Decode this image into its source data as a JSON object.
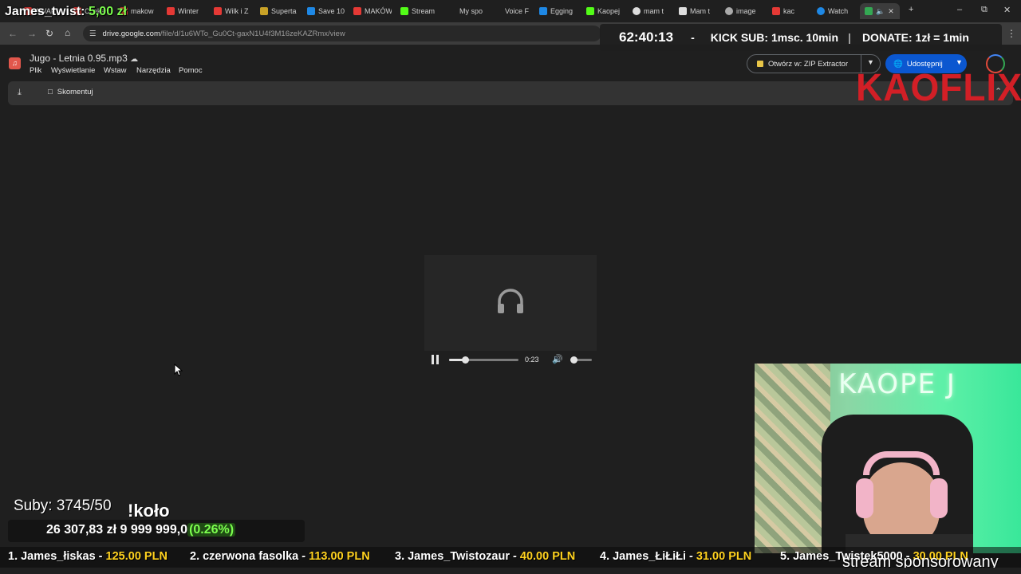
{
  "browser": {
    "tabs": [
      {
        "label": "AWAF",
        "color": "#e53935"
      },
      {
        "label": "Czeka",
        "color": "#e53935"
      },
      {
        "label": "makow",
        "color": "#e53935"
      },
      {
        "label": "Winter",
        "color": "#e53935"
      },
      {
        "label": "Wilk i Z",
        "color": "#e53935"
      },
      {
        "label": "Superta",
        "color": "#c9a227"
      },
      {
        "label": "Save 10",
        "color": "#1e88e5"
      },
      {
        "label": "MAKÓW",
        "color": "#e53935"
      },
      {
        "label": "Stream",
        "color": "#53fc18"
      },
      {
        "label": "My spo",
        "color": "#555555"
      },
      {
        "label": "Voice F",
        "color": "#555555"
      },
      {
        "label": "Egging",
        "color": "#1e88e5"
      },
      {
        "label": "Kaopej",
        "color": "#53fc18"
      },
      {
        "label": "mam t",
        "color": "#dddddd"
      },
      {
        "label": "Mam t",
        "color": "#dddddd"
      },
      {
        "label": "image",
        "color": "#aaaaaa"
      },
      {
        "label": "kac",
        "color": "#e53935"
      },
      {
        "label": "Watch",
        "color": "#1e88e5"
      }
    ],
    "new_tab": "+",
    "url_host": "drive.google.com",
    "url_path": "/file/d/1u6WTo_Gu0Ct-gaxN1U4f3M16zeKAZRmx/view"
  },
  "drive": {
    "file_title": "Jugo - Letnia 0.95.mp3",
    "menu": [
      "Plik",
      "Wyświetlanie",
      "Wstaw",
      "Narzędzia",
      "Pomoc"
    ],
    "open_with": "Otwórz w: ZIP Extractor",
    "share": "Udostępnij",
    "comment": "Skomentuj"
  },
  "player": {
    "time": "0:23",
    "progress": 0.23,
    "volume": 0.15
  },
  "overlay": {
    "top_donor_name": "James_twist:",
    "top_donor_amount": "5,00 zł",
    "timer": "62:40:13",
    "dash": "-",
    "kick_sub": "KICK SUB: 1msc. 10min",
    "bar_sep": "|",
    "donate": "DONATE: 1zł = 1min",
    "brand": "KAOFLIX",
    "neon": "KAOPE J",
    "subs": "Suby: 3745/50",
    "kolo": "!koło",
    "goal_current": "26 307,83 zł",
    "goal_target": "9 999 999,0",
    "goal_percent": "(0.26%)",
    "ticker": [
      {
        "name": "1. James_łiskas - ",
        "value": "125.00 PLN"
      },
      {
        "name": "2. czerwona fasolka - ",
        "value": "113.00 PLN"
      },
      {
        "name": "3. James_Twistozaur - ",
        "value": "40.00 PLN"
      },
      {
        "name": "4. James_ŁiŁiŁi - ",
        "value": "31.00 PLN"
      },
      {
        "name": "5. James_Twistek5000 - ",
        "value": "30.00 PLN"
      }
    ],
    "sponsored": "stream sponsorowany"
  }
}
